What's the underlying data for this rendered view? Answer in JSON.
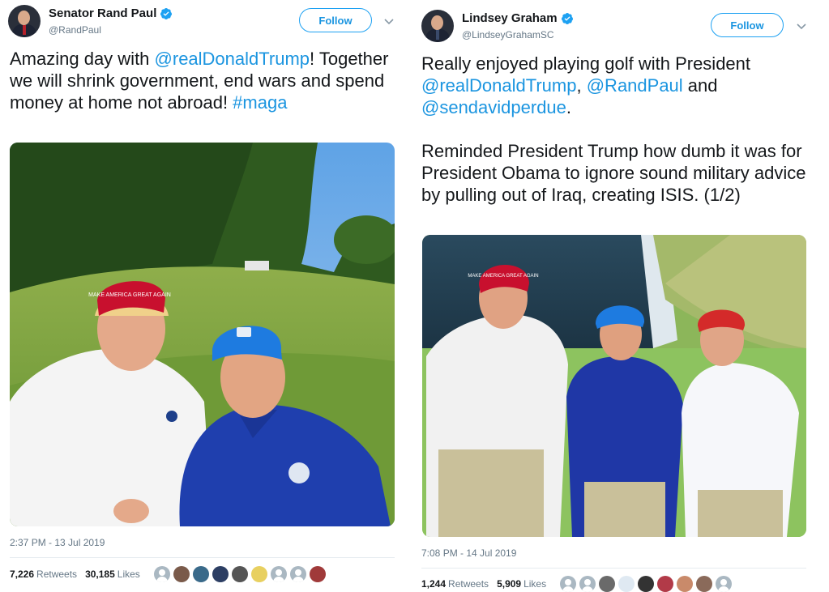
{
  "left_tweet": {
    "author": {
      "name": "Senator Rand Paul",
      "handle": "@RandPaul",
      "verified": true
    },
    "follow_label": "Follow",
    "text": {
      "p1_a": "Amazing day with ",
      "p1_mention": "@realDonaldTrump",
      "p1_b": "! Together we will shrink government, end wars and spend money at home not abroad! ",
      "p1_hashtag": "#maga"
    },
    "photo": {
      "hat_left_text": "MAKE AMERICA GREAT AGAIN"
    },
    "timestamp": "2:37 PM - 13 Jul 2019",
    "retweets": {
      "count": "7,226",
      "label": "Retweets"
    },
    "likes": {
      "count": "30,185",
      "label": "Likes"
    },
    "liker_avatars": [
      "default",
      "photo",
      "photo",
      "photo",
      "photo",
      "emoji",
      "default",
      "default",
      "photo"
    ]
  },
  "right_tweet": {
    "author": {
      "name": "Lindsey Graham",
      "handle": "@LindseyGrahamSC",
      "verified": true
    },
    "follow_label": "Follow",
    "text": {
      "p1_a": "Really enjoyed playing golf with President ",
      "p1_m1": "@realDonaldTrump",
      "p1_sep1": ", ",
      "p1_m2": "@RandPaul",
      "p1_sep2": " and ",
      "p1_m3": "@sendavidperdue",
      "p1_end": ".",
      "p2": "Reminded President Trump how dumb it was for President Obama to ignore sound military advice by pulling out of Iraq, creating ISIS. (1/2)"
    },
    "photo": {
      "hat_left_text": "MAKE AMERICA GREAT AGAIN"
    },
    "timestamp": "7:08 PM - 14 Jul 2019",
    "retweets": {
      "count": "1,244",
      "label": "Retweets"
    },
    "likes": {
      "count": "5,909",
      "label": "Likes"
    },
    "liker_avatars": [
      "default",
      "default",
      "photo",
      "emoji",
      "photo",
      "photo",
      "photo",
      "photo",
      "default"
    ]
  },
  "colors": {
    "link": "#1b95e0",
    "verified": "#1da1f2",
    "secondary_text": "#657786",
    "border": "#e6ecf0"
  }
}
